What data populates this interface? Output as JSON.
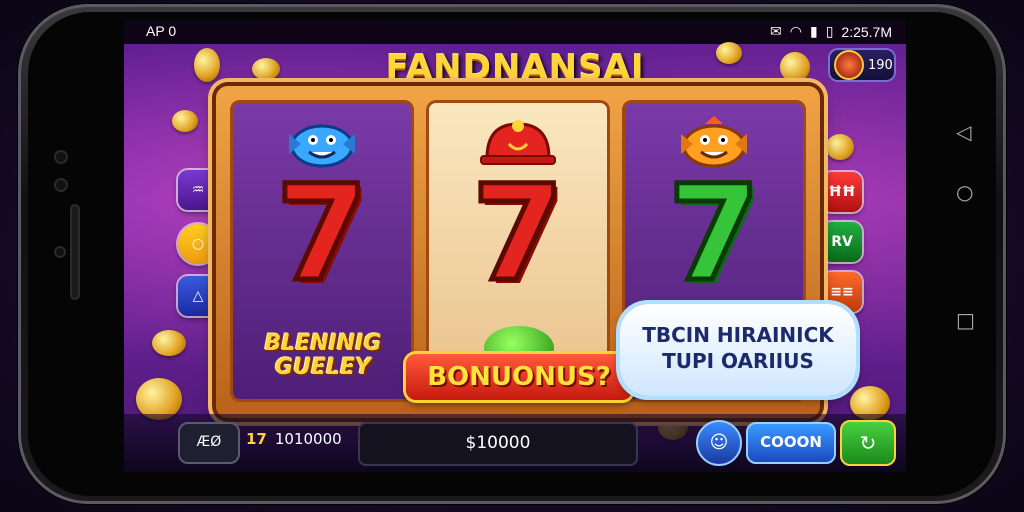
{
  "status_bar": {
    "left_text": "AP 0",
    "icons": [
      "notification-icon",
      "wifi-icon",
      "signal-icon",
      "battery-icon"
    ],
    "time": "2:25.7M"
  },
  "game": {
    "title": "FANDNANSAI",
    "top_badge_value": "190",
    "reels": [
      {
        "top_symbol": "blue-fish",
        "seven_color": "#e4241e",
        "bottom_label": "BLENINIG GUELEY"
      },
      {
        "top_symbol": "red-helmet",
        "seven_color": "#e4241e",
        "bottom_label": ""
      },
      {
        "top_symbol": "orange-fish",
        "seven_color": "#36c43a",
        "bottom_label": ""
      }
    ],
    "seven_glyph": "7",
    "bonus_banner": "BONUONUS?",
    "bubble_line1": "TBCIN HIRAINICK",
    "bubble_line2": "TUPI OARIIUS",
    "left_buttons": [
      "♒",
      "○",
      "△"
    ],
    "right_buttons": [
      "ĦĦ",
      "RV",
      "≡≡"
    ]
  },
  "bottom_bar": {
    "left_button": "ÆØ",
    "credit_mark": "17",
    "credit_value": "1010000",
    "bet_value": "$10000",
    "round_button_icon": "☺",
    "coin_button": "COOON",
    "spin_button_icon": "↻"
  },
  "colors": {
    "title_gold": "#ffd53a",
    "frame_orange": "#f1a445",
    "bonus_red": "#c61a10"
  }
}
